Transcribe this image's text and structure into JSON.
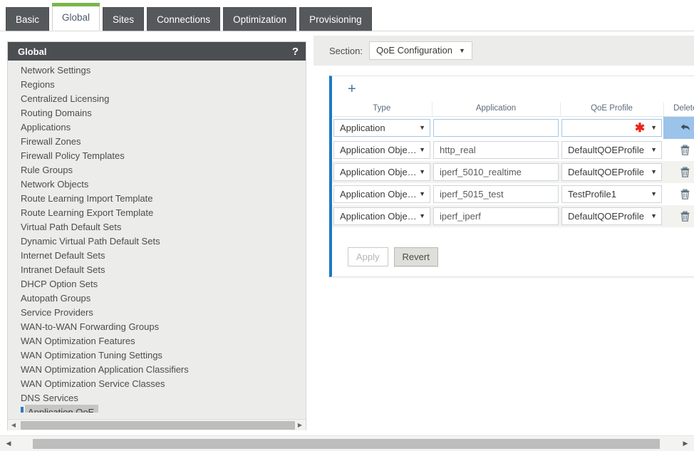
{
  "tabs": [
    {
      "label": "Basic",
      "active": false
    },
    {
      "label": "Global",
      "active": true
    },
    {
      "label": "Sites",
      "active": false
    },
    {
      "label": "Connections",
      "active": false
    },
    {
      "label": "Optimization",
      "active": false
    },
    {
      "label": "Provisioning",
      "active": false
    }
  ],
  "sidebar": {
    "title": "Global",
    "help_icon": "question-mark-icon",
    "items": [
      {
        "label": "Network Settings",
        "selected": false
      },
      {
        "label": "Regions",
        "selected": false
      },
      {
        "label": "Centralized Licensing",
        "selected": false
      },
      {
        "label": "Routing Domains",
        "selected": false
      },
      {
        "label": "Applications",
        "selected": false
      },
      {
        "label": "Firewall Zones",
        "selected": false
      },
      {
        "label": "Firewall Policy Templates",
        "selected": false
      },
      {
        "label": "Rule Groups",
        "selected": false
      },
      {
        "label": "Network Objects",
        "selected": false
      },
      {
        "label": "Route Learning Import Template",
        "selected": false
      },
      {
        "label": "Route Learning Export Template",
        "selected": false
      },
      {
        "label": "Virtual Path Default Sets",
        "selected": false
      },
      {
        "label": "Dynamic Virtual Path Default Sets",
        "selected": false
      },
      {
        "label": "Internet Default Sets",
        "selected": false
      },
      {
        "label": "Intranet Default Sets",
        "selected": false
      },
      {
        "label": "DHCP Option Sets",
        "selected": false
      },
      {
        "label": "Autopath Groups",
        "selected": false
      },
      {
        "label": "Service Providers",
        "selected": false
      },
      {
        "label": "WAN-to-WAN Forwarding Groups",
        "selected": false
      },
      {
        "label": "WAN Optimization Features",
        "selected": false
      },
      {
        "label": "WAN Optimization Tuning Settings",
        "selected": false
      },
      {
        "label": "WAN Optimization Application Classifiers",
        "selected": false
      },
      {
        "label": "WAN Optimization Service Classes",
        "selected": false
      },
      {
        "label": "DNS Services",
        "selected": false
      },
      {
        "label": "Application QoE",
        "selected": true
      }
    ]
  },
  "section": {
    "label": "Section:",
    "selected": "QoE Configuration",
    "caret": "▼"
  },
  "panel": {
    "add_icon": "plus-icon",
    "menu_icon": "kebab-menu-icon",
    "table": {
      "headers": [
        "Type",
        "Application",
        "QoE Profile",
        "Delete"
      ],
      "rows": [
        {
          "type": "Application",
          "application": "",
          "profile": "",
          "profile_required": true,
          "action_icon": "undo-icon",
          "editing": true
        },
        {
          "type": "Application Objects",
          "application": "http_real",
          "profile": "DefaultQOEProfile",
          "profile_required": false,
          "action_icon": "trash-icon",
          "editing": false
        },
        {
          "type": "Application Objects",
          "application": "iperf_5010_realtime",
          "profile": "DefaultQOEProfile",
          "profile_required": false,
          "action_icon": "trash-icon",
          "editing": false
        },
        {
          "type": "Application Objects",
          "application": "iperf_5015_test",
          "profile": "TestProfile1",
          "profile_required": false,
          "action_icon": "trash-icon",
          "editing": false
        },
        {
          "type": "Application Objects",
          "application": "iperf_iperf",
          "profile": "DefaultQOEProfile",
          "profile_required": false,
          "action_icon": "trash-icon",
          "editing": false
        }
      ]
    },
    "apply_label": "Apply",
    "revert_label": "Revert",
    "apply_enabled": false,
    "revert_enabled": true
  },
  "colors": {
    "tab_inactive_bg": "#55595c",
    "tab_active_accent": "#7ab648",
    "sidebar_header_bg": "#4b4f52",
    "panel_accent": "#1a7ac4",
    "selected_row_bg": "#9cc3ea",
    "required_star": "#e8241c"
  },
  "scrollbars": {
    "left_arrow": "◀",
    "right_arrow": "▶"
  }
}
